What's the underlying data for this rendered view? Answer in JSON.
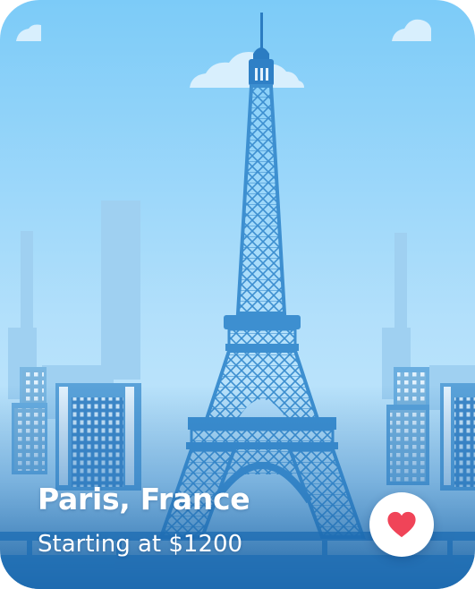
{
  "card": {
    "title": "Paris, France",
    "subtitle": "Starting at $1200"
  },
  "favorite": {
    "icon": "heart-icon",
    "active": true,
    "color": "#f04458"
  },
  "colors": {
    "sky_top": "#7ccbf8",
    "sky_bottom": "#bfe5fb",
    "tower": "#3d8fd0",
    "footer": "#1e6db3"
  }
}
